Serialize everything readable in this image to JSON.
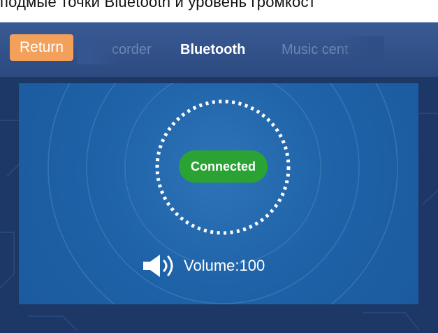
{
  "caption": {
    "text": "подмые точки Bluetooth и уровень громкост"
  },
  "header": {
    "return_label": "Return",
    "tabs": [
      {
        "label": "corder",
        "state": "inactive"
      },
      {
        "label": "Bluetooth",
        "state": "active"
      },
      {
        "label": "Music cent",
        "state": "inactive"
      }
    ]
  },
  "bluetooth": {
    "status": "Connected",
    "status_color": "#2aa234",
    "volume_label": "Volume:100",
    "volume_level": 100
  },
  "icons": {
    "speaker": "speaker-icon",
    "connection_ring": "dotted-ring-icon"
  },
  "colors": {
    "return_button": "#f3a15a",
    "background": "#1d3766",
    "panel": "#1f63a8"
  }
}
